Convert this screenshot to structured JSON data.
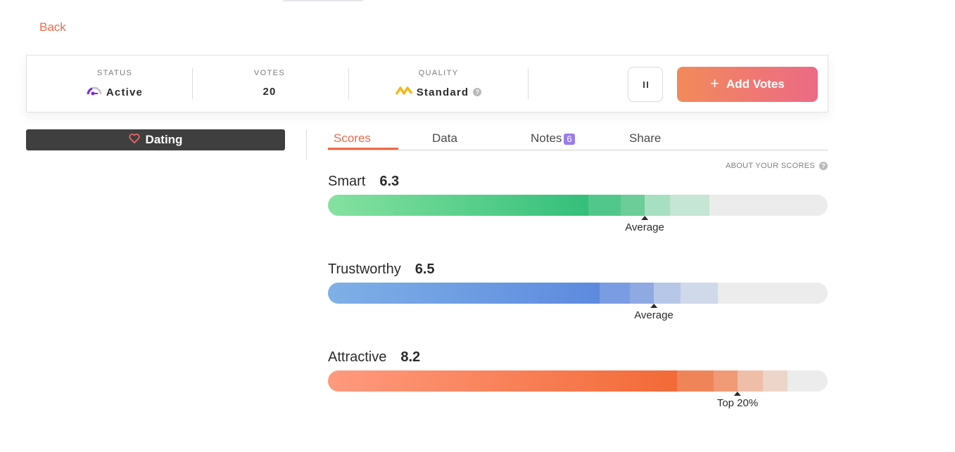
{
  "nav": {
    "back_label": "Back"
  },
  "status": {
    "status_label": "STATUS",
    "status_value": "Active",
    "votes_label": "VOTES",
    "votes_value": "20",
    "quality_label": "QUALITY",
    "quality_value": "Standard"
  },
  "actions": {
    "add_votes_label": "Add Votes"
  },
  "category": {
    "label": "Dating"
  },
  "tabs": [
    {
      "label": "Scores",
      "active": true
    },
    {
      "label": "Data"
    },
    {
      "label": "Notes",
      "badge": "6"
    },
    {
      "label": "Share"
    }
  ],
  "about_label": "ABOUT YOUR SCORES",
  "scores": [
    {
      "label": "Smart",
      "value": "6.3",
      "marker": "Average",
      "marker_fraction": 0.634,
      "fill_colors": [
        "#86e1a0",
        "#34bf7a",
        "#52c78b",
        "#6ccd99",
        "#a7dfc2",
        "#c5e5d5"
      ]
    },
    {
      "label": "Trustworthy",
      "value": "6.5",
      "marker": "Average",
      "marker_fraction": 0.652,
      "fill_colors": [
        "#7fb0e6",
        "#5d8ade",
        "#7a9ce2",
        "#8fa9e2",
        "#b7c7e8",
        "#cfd9ea"
      ]
    },
    {
      "label": "Attractive",
      "value": "8.2",
      "marker": "Top 20%",
      "marker_fraction": 0.82,
      "fill_colors": [
        "#ff9a7e",
        "#f26a37",
        "#f08459",
        "#f09a76",
        "#efbea8",
        "#eed5ca"
      ]
    }
  ]
}
